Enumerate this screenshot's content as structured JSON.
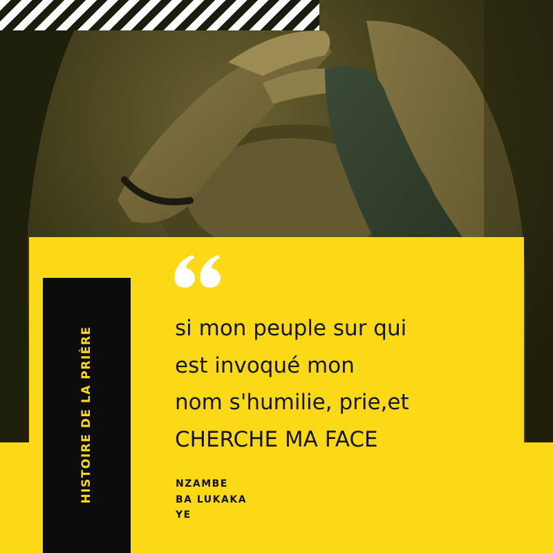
{
  "side_label": "HISTOIRE DE LA PRIÈRE",
  "quote": {
    "lines": [
      "si mon peuple sur qui",
      "est invoqué mon",
      "nom s'humilie, prie,et",
      "CHERCHE MA FACE"
    ]
  },
  "author": {
    "lines": [
      "NZAMBE",
      "BA LUKAKA",
      "YE"
    ]
  },
  "icons": {
    "quote": "quote-mark-icon"
  },
  "colors": {
    "accent_yellow": "#fcd917",
    "panel_black": "#0c0c0c",
    "photo_tint": "#3a3a14",
    "text_dark": "#151515"
  }
}
